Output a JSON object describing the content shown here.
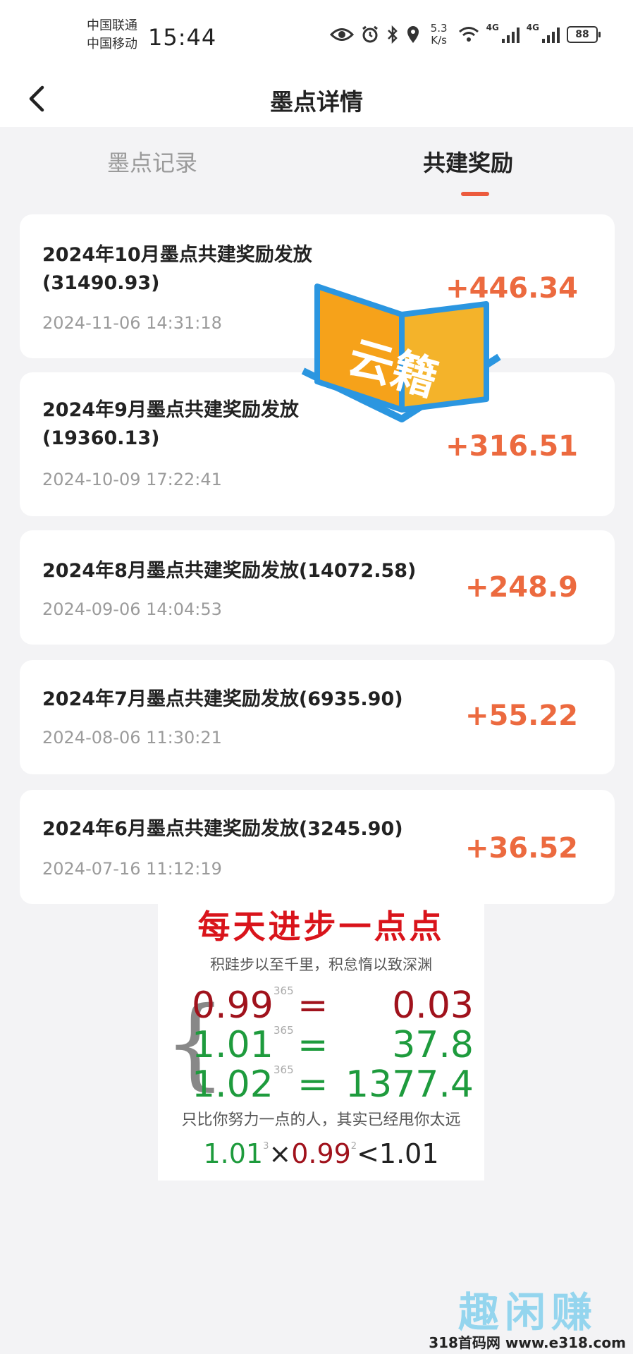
{
  "status_bar": {
    "carrier_1": "中国联通",
    "carrier_2": "中国移动",
    "time": "15:44",
    "speed_value": "5.3",
    "speed_unit": "K/s",
    "network_1": "4G",
    "network_2": "4G",
    "battery": "88"
  },
  "header": {
    "title": "墨点详情"
  },
  "tabs": [
    {
      "label": "墨点记录",
      "active": false
    },
    {
      "label": "共建奖励",
      "active": true
    }
  ],
  "records": [
    {
      "title": "2024年10月墨点共建奖励发放(31490.93)",
      "time": "2024-11-06 14:31:18",
      "amount": "+446.34"
    },
    {
      "title": "2024年9月墨点共建奖励发放(19360.13)",
      "time": "2024-10-09 17:22:41",
      "amount": "+316.51"
    },
    {
      "title": "2024年8月墨点共建奖励发放(14072.58)",
      "time": "2024-09-06 14:04:53",
      "amount": "+248.9"
    },
    {
      "title": "2024年7月墨点共建奖励发放(6935.90)",
      "time": "2024-08-06 11:30:21",
      "amount": "+55.22"
    },
    {
      "title": "2024年6月墨点共建奖励发放(3245.90)",
      "time": "2024-07-16 11:12:19",
      "amount": "+36.52"
    }
  ],
  "badge": {
    "text": "云籍"
  },
  "poster": {
    "title": "每天进步一点点",
    "subtitle": "积跬步以至千里，积怠惰以致深渊",
    "rows": [
      {
        "base": "0.99",
        "exp": "365",
        "eq": "=",
        "result": "0.03"
      },
      {
        "base": "1.01",
        "exp": "365",
        "eq": "=",
        "result": "37.8"
      },
      {
        "base": "1.02",
        "exp": "365",
        "eq": "=",
        "result": "1377.4"
      }
    ],
    "note": "只比你努力一点的人，其实已经甩你太远",
    "formula": {
      "a": "1.01",
      "a_exp": "3",
      "op": "×",
      "b": "0.99",
      "b_exp": "2",
      "cmp": "<",
      "c": "1.01"
    }
  },
  "watermark": {
    "brand": "趣闲赚",
    "url": "318首码网 www.e318.com"
  },
  "colors": {
    "accent": "#ec6a3f",
    "tab_indicator": "#ec5a3d",
    "background": "#f3f3f5"
  }
}
